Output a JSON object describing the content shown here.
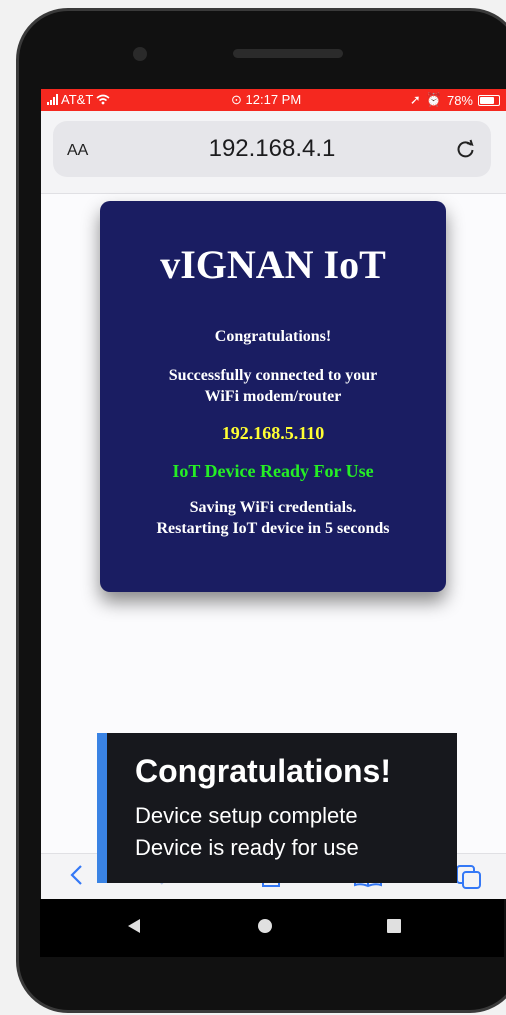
{
  "status_bar": {
    "carrier": "AT&T",
    "time": "12:17 PM",
    "battery": "78%"
  },
  "browser": {
    "text_size_label": "AA",
    "url": "192.168.4.1"
  },
  "card": {
    "title": "vIGNAN IoT",
    "congrats": "Congratulations!",
    "connected_line1": "Successfully connected to your",
    "connected_line2": "WiFi modem/router",
    "ip": "192.168.5.110",
    "ready": "IoT Device Ready For Use",
    "saving_line1": "Saving WiFi credentials.",
    "saving_line2": "Restarting IoT device in 5 seconds",
    "colors": {
      "background": "#1a1d62",
      "ip": "#ffff33",
      "ready": "#25ee25"
    }
  },
  "overlay": {
    "heading": "Congratulations!",
    "line1": "Device setup complete",
    "line2": "Device is ready for use",
    "accent_color": "#3a83e4"
  },
  "icons": {
    "reload": "reload-icon",
    "back": "chevron-left-icon",
    "share": "share-icon",
    "bookmarks": "book-icon",
    "tabs": "tabs-icon"
  }
}
